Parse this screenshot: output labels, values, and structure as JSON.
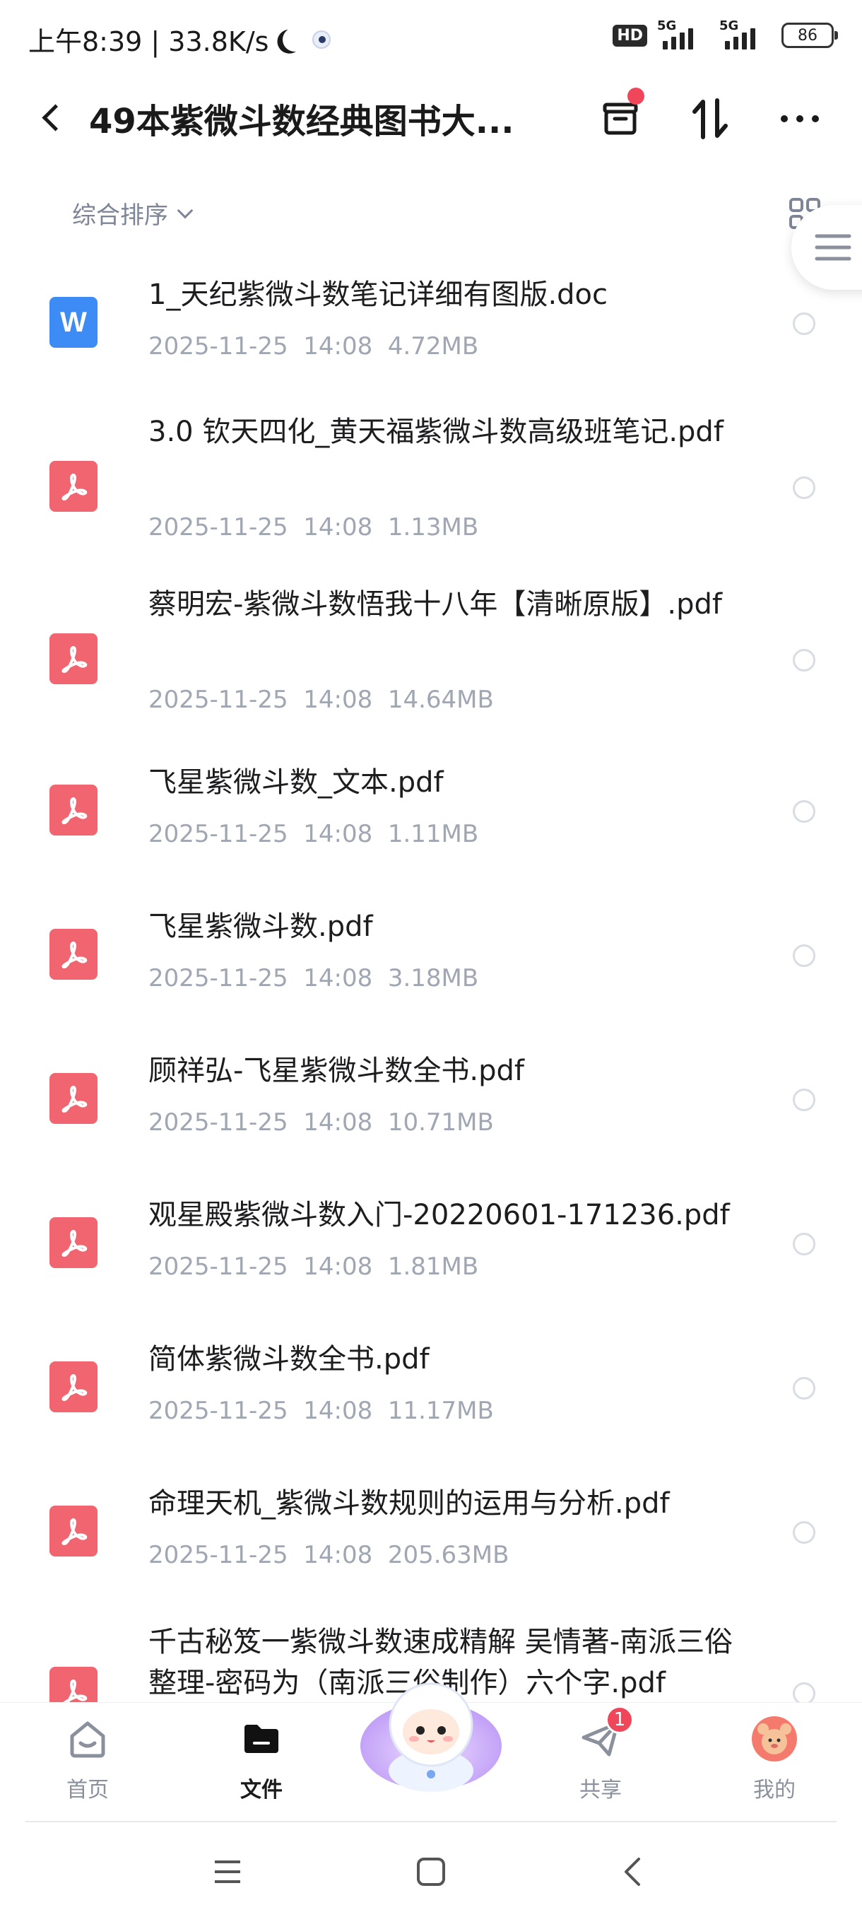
{
  "status_bar": {
    "time_speed": "上午8:39 | 33.8K/s",
    "hd_label": "HD",
    "net1": "5G",
    "net2": "5G",
    "battery": "86"
  },
  "header": {
    "title": "49本紫微斗数经典图书大..."
  },
  "toolbar": {
    "sort_label": "综合排序"
  },
  "files": [
    {
      "name": "1_天纪紫微斗数笔记详细有图版.doc",
      "date": "2025-11-25",
      "time": "14:08",
      "size": "4.72MB",
      "type": "doc",
      "icon_letter": "W"
    },
    {
      "name": "3.0 钦天四化_黄天福紫微斗数高级班笔记.pdf",
      "date": "2025-11-25",
      "time": "14:08",
      "size": "1.13MB",
      "type": "pdf"
    },
    {
      "name": "蔡明宏-紫微斗数悟我十八年【清晰原版】.pdf",
      "date": "2025-11-25",
      "time": "14:08",
      "size": "14.64MB",
      "type": "pdf"
    },
    {
      "name": "飞星紫微斗数_文本.pdf",
      "date": "2025-11-25",
      "time": "14:08",
      "size": "1.11MB",
      "type": "pdf"
    },
    {
      "name": "飞星紫微斗数.pdf",
      "date": "2025-11-25",
      "time": "14:08",
      "size": "3.18MB",
      "type": "pdf"
    },
    {
      "name": "顾祥弘-飞星紫微斗数全书.pdf",
      "date": "2025-11-25",
      "time": "14:08",
      "size": "10.71MB",
      "type": "pdf"
    },
    {
      "name": "观星殿紫微斗数入门-20220601-171236.pdf",
      "date": "2025-11-25",
      "time": "14:08",
      "size": "1.81MB",
      "type": "pdf"
    },
    {
      "name": "简体紫微斗数全书.pdf",
      "date": "2025-11-25",
      "time": "14:08",
      "size": "11.17MB",
      "type": "pdf"
    },
    {
      "name": "命理天机_紫微斗数规则的运用与分析.pdf",
      "date": "2025-11-25",
      "time": "14:08",
      "size": "205.63MB",
      "type": "pdf"
    },
    {
      "name": "千古秘笈一紫微斗数速成精解 吴情著-南派三俗整理-密码为（南派三俗制作）六个字.pdf",
      "date": "",
      "time": "",
      "size": "",
      "type": "pdf"
    }
  ],
  "bottom_nav": {
    "home": "首页",
    "files": "文件",
    "share": "共享",
    "share_badge": "1",
    "mine": "我的"
  },
  "icons": {
    "back": "back-arrow-icon",
    "archive": "archive-box-icon",
    "sort": "sort-arrows-icon",
    "more": "more-dots-icon",
    "grid": "grid-view-icon",
    "menu": "hamburger-menu-icon"
  },
  "colors": {
    "pdf_icon": "#f06570",
    "doc_icon": "#3d8bf5",
    "badge": "#f0465a",
    "meta_text": "#a0a6b2"
  }
}
